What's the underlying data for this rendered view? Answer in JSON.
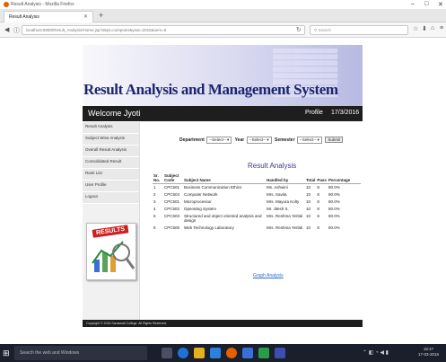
{
  "browser": {
    "window_title": "Result Analysis - Mozilla Firefox",
    "tab_title": "Result Analysis",
    "url": "localhost:8080/Result_Analysis/Home.jsp?dept=computer&year=2015&sem=5",
    "search_placeholder": "Search"
  },
  "page": {
    "site_title": "Result Analysis and Management System",
    "welcome": "Welcome Jyoti",
    "profile": "Profile",
    "date": "17/3/2016"
  },
  "sidebar": {
    "items": [
      {
        "label": "Result Analysis"
      },
      {
        "label": "Subject Wise Analysis"
      },
      {
        "label": "Overall Result Analysis"
      },
      {
        "label": "Consolidated Result"
      },
      {
        "label": "Rank List"
      },
      {
        "label": "User Profile"
      },
      {
        "label": "Logout"
      }
    ],
    "results_label": "RESULTS"
  },
  "filters": {
    "department_label": "Department",
    "department_value": "--Select--",
    "year_label": "Year",
    "year_value": "--Select--",
    "semester_label": "Semester",
    "semester_value": "--Select--",
    "submit_label": "Submit"
  },
  "results": {
    "title": "Result Analysis",
    "columns": [
      "Sr. No.",
      "Subject Code",
      "Subject Name",
      "Handled by",
      "Total",
      "Pass",
      "Percentage"
    ],
    "rows": [
      {
        "sr": "1",
        "code": "CPC501",
        "name": "Business Communication Ethics",
        "handled": "Ms. Ashwini",
        "total": "10",
        "pass": "8",
        "pct": "80.0%"
      },
      {
        "sr": "2",
        "code": "CPC504",
        "name": "Computer Network",
        "handled": "Mrs. Savita",
        "total": "10",
        "pass": "8",
        "pct": "80.0%"
      },
      {
        "sr": "3",
        "code": "CPC501",
        "name": "Microprocessor",
        "handled": "Mrs. Mayura Kolty",
        "total": "10",
        "pass": "8",
        "pct": "80.0%"
      },
      {
        "sr": "4",
        "code": "CPC502",
        "name": "Operating System",
        "handled": "Mr. Jitesh S.",
        "total": "10",
        "pass": "8",
        "pct": "80.0%"
      },
      {
        "sr": "5",
        "code": "CPC503",
        "name": "Structured and object oriented analysis and design",
        "handled": "Mrs. Reshma Yerlak",
        "total": "10",
        "pass": "8",
        "pct": "80.0%"
      },
      {
        "sr": "6",
        "code": "CPC505",
        "name": "Web Technology Laboratory",
        "handled": "Mrs. Reshma Yerlak",
        "total": "10",
        "pass": "8",
        "pct": "80.0%"
      }
    ],
    "graph_link": "Graph Analysis"
  },
  "footer": {
    "copyright": "Copyright © 2016 Saraswati College. All Rights Reserved."
  },
  "taskbar": {
    "search_placeholder": "Search the web and Windows",
    "time": "18:47",
    "date": "17-03-2016"
  },
  "colors": {
    "title_blue": "#1c2470",
    "bar_dark": "#1e1e1e",
    "link_blue": "#2a6ad8",
    "results_red": "#cc2020"
  }
}
